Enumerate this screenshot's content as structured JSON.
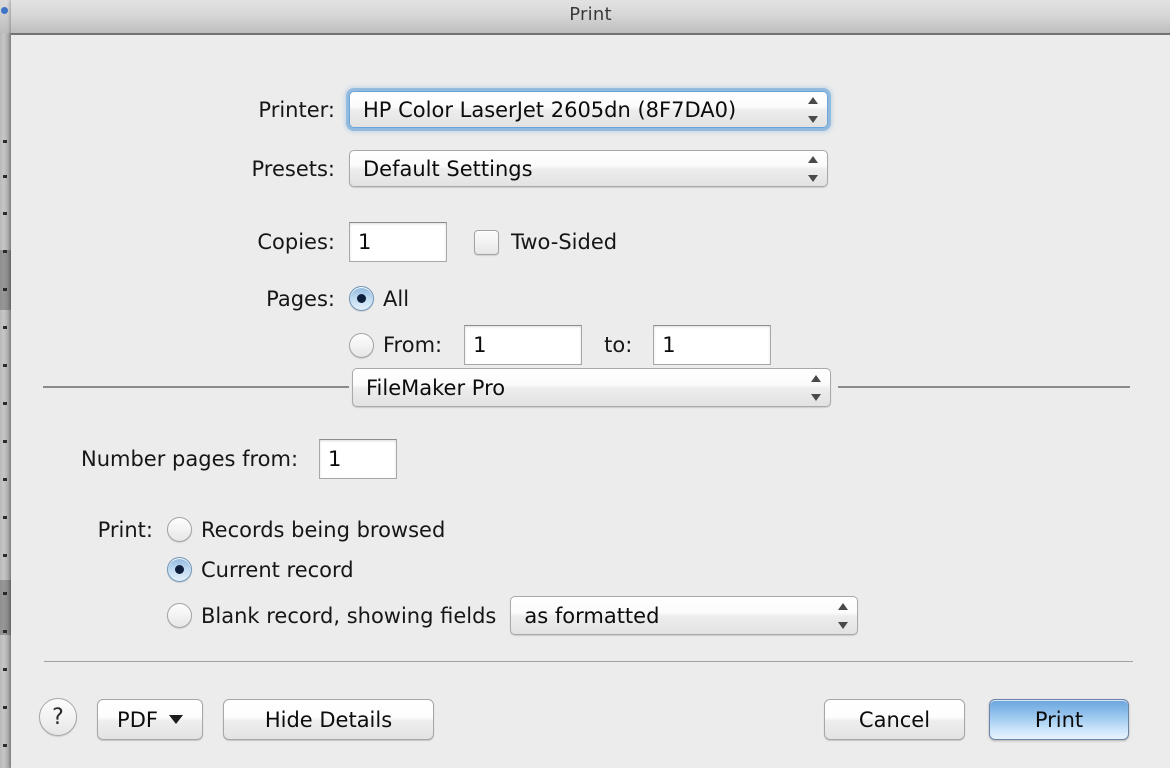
{
  "window": {
    "title": "Print"
  },
  "printer_row": {
    "label": "Printer:",
    "value": "HP Color LaserJet 2605dn (8F7DA0)",
    "focused": true
  },
  "presets_row": {
    "label": "Presets:",
    "value": "Default Settings"
  },
  "copies_row": {
    "label": "Copies:",
    "value": "1",
    "two_sided_label": "Two-Sided",
    "two_sided_checked": false
  },
  "pages_row": {
    "label": "Pages:",
    "all_label": "All",
    "all_selected": true,
    "from_label": "From:",
    "from_value": "1",
    "to_label": "to:",
    "to_value": "1",
    "range_selected": false
  },
  "module_popup": {
    "value": "FileMaker Pro"
  },
  "number_pages_row": {
    "label": "Number pages from:",
    "value": "1"
  },
  "print_options": {
    "label": "Print:",
    "options": [
      {
        "label": "Records being browsed",
        "selected": false
      },
      {
        "label": "Current record",
        "selected": true
      },
      {
        "label": "Blank record, showing fields",
        "selected": false
      }
    ],
    "blank_fields_popup": "as formatted"
  },
  "footer": {
    "help_glyph": "?",
    "pdf_label": "PDF",
    "hide_details_label": "Hide Details",
    "cancel_label": "Cancel",
    "print_label": "Print"
  },
  "colors": {
    "dialog_bg": "#ececec",
    "titlebar_top": "#e4e4e4",
    "titlebar_bottom": "#bebebe",
    "accent_blue": "#6ba4dd",
    "focus_ring": "#6aa4d8",
    "separator": "#8a8a8a",
    "text": "#0c0c0c"
  }
}
